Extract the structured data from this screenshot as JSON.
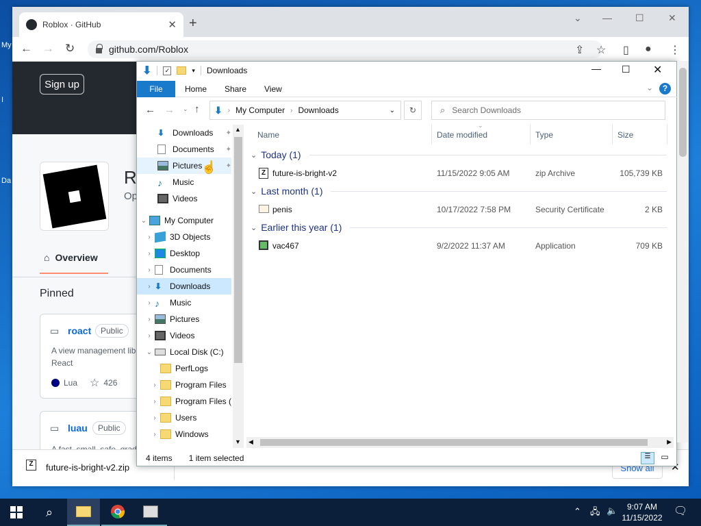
{
  "desktop": {
    "labels": [
      "My",
      "I",
      "Da"
    ]
  },
  "browser": {
    "tab_title": "Roblox · GitHub",
    "url": "github.com/Roblox",
    "signup": "Sign up",
    "org_initial": "R",
    "org_sub": "Op",
    "overview_tab": "Overview",
    "pinned": "Pinned",
    "cards": [
      {
        "name": "roact",
        "badge": "Public",
        "desc": "A view management lib to React",
        "lang": "Lua",
        "stars": "426"
      },
      {
        "name": "luau",
        "badge": "Public",
        "desc": "A fast, small, safe, grad"
      }
    ],
    "download": {
      "file": "future-is-bright-v2.zip",
      "show_all": "Show all"
    }
  },
  "explorer": {
    "title": "Downloads",
    "ribbon": [
      "File",
      "Home",
      "Share",
      "View"
    ],
    "breadcrumb": [
      "My Computer",
      "Downloads"
    ],
    "search_placeholder": "Search Downloads",
    "nav": [
      {
        "label": "Downloads",
        "icon": "download-arrow-icon",
        "pinned": true
      },
      {
        "label": "Documents",
        "icon": "document-icon",
        "pinned": true
      },
      {
        "label": "Pictures",
        "icon": "pictures-icon",
        "pinned": true
      },
      {
        "label": "Music",
        "icon": "music-note-icon"
      },
      {
        "label": "Videos",
        "icon": "film-icon"
      },
      {
        "label": "My Computer",
        "icon": "computer-icon",
        "expanded": true
      },
      {
        "label": "3D Objects",
        "icon": "cube-icon"
      },
      {
        "label": "Desktop",
        "icon": "desktop-icon"
      },
      {
        "label": "Documents",
        "icon": "document-icon"
      },
      {
        "label": "Downloads",
        "icon": "download-arrow-icon",
        "selected": true
      },
      {
        "label": "Music",
        "icon": "music-note-icon"
      },
      {
        "label": "Pictures",
        "icon": "pictures-icon"
      },
      {
        "label": "Videos",
        "icon": "film-icon"
      },
      {
        "label": "Local Disk (C:)",
        "icon": "drive-icon",
        "expanded": true
      },
      {
        "label": "PerfLogs",
        "icon": "folder-icon"
      },
      {
        "label": "Program Files",
        "icon": "folder-icon"
      },
      {
        "label": "Program Files (",
        "icon": "folder-icon"
      },
      {
        "label": "Users",
        "icon": "folder-icon"
      },
      {
        "label": "Windows",
        "icon": "folder-icon"
      }
    ],
    "columns": [
      "Name",
      "Date modified",
      "Type",
      "Size"
    ],
    "groups": [
      {
        "title": "Today (1)",
        "files": [
          {
            "name": "future-is-bright-v2",
            "date": "11/15/2022 9:05 AM",
            "type": "zip Archive",
            "size": "105,739 KB",
            "icon": "zip-icon"
          }
        ]
      },
      {
        "title": "Last month (1)",
        "files": [
          {
            "name": "penis",
            "date": "10/17/2022 7:58 PM",
            "type": "Security Certificate",
            "size": "2 KB",
            "icon": "certificate-icon"
          }
        ]
      },
      {
        "title": "Earlier this year (1)",
        "files": [
          {
            "name": "vac467",
            "date": "9/2/2022 11:37 AM",
            "type": "Application",
            "size": "709 KB",
            "icon": "application-icon"
          }
        ]
      }
    ],
    "status": {
      "count": "4 items",
      "selected": "1 item selected"
    }
  },
  "taskbar": {
    "time": "9:07 AM",
    "date": "11/15/2022"
  }
}
